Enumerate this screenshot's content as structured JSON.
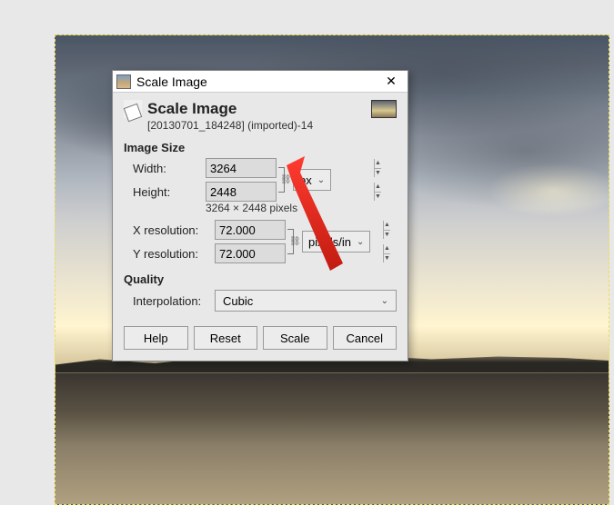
{
  "titlebar": {
    "title": "Scale Image"
  },
  "header": {
    "title": "Scale Image",
    "subtitle": "[20130701_184248] (imported)-14"
  },
  "sections": {
    "image_size": "Image Size",
    "quality": "Quality"
  },
  "labels": {
    "width": "Width:",
    "height": "Height:",
    "xres": "X resolution:",
    "yres": "Y resolution:",
    "interpolation": "Interpolation:"
  },
  "values": {
    "width": "3264",
    "height": "2448",
    "xres": "72.000",
    "yres": "72.000",
    "dims_text": "3264 × 2448 pixels"
  },
  "units": {
    "size": "px",
    "resolution": "pixels/in"
  },
  "interpolation": "Cubic",
  "buttons": {
    "help": "Help",
    "reset": "Reset",
    "scale": "Scale",
    "cancel": "Cancel"
  }
}
